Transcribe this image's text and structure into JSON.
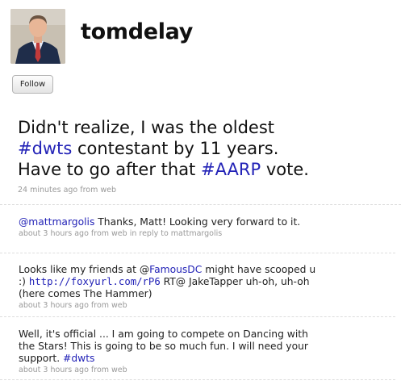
{
  "profile": {
    "username": "tomdelay",
    "follow_label": "Follow"
  },
  "featured": {
    "lines": [
      [
        "Didn't realize, I was the oldest"
      ],
      [
        "#dwts",
        " contestant by 11 years."
      ],
      [
        "Have to go after that ",
        "#AARP",
        " vote."
      ]
    ],
    "line1": "Didn't realize, I was the oldest",
    "line2_tag": "#dwts",
    "line2_rest": " contestant by 11 years.",
    "line3_pre": "Have to go after that ",
    "line3_tag": "#AARP",
    "line3_post": " vote.",
    "meta": "24 minutes ago from web"
  },
  "tweets": [
    {
      "mention": "@mattmargolis",
      "text": " Thanks, Matt! Looking very forward to it.",
      "meta": "about 3 hours ago from web in reply to mattmargolis"
    },
    {
      "l1_pre": "Looks like my friends at @",
      "l1_link": "FamousDC",
      "l1_post": " might have scooped u",
      "l2_pre": ":) ",
      "l2_link": "http://foxyurl.com/rP6",
      "l2_post": " RT@ JakeTapper uh-oh, uh-oh",
      "l3": "(here comes The Hammer)",
      "meta": "about 3 hours ago from web"
    },
    {
      "l1": "Well, it's official ... I am going to compete on Dancing with",
      "l2": "the Stars! This is going to be so much fun. I will need your",
      "l3_pre": "support. ",
      "l3_tag": "#dwts",
      "meta": "about 3 hours ago from web"
    }
  ],
  "colors": {
    "link": "#2323b7",
    "meta": "#999999",
    "divider": "#dddddd"
  }
}
